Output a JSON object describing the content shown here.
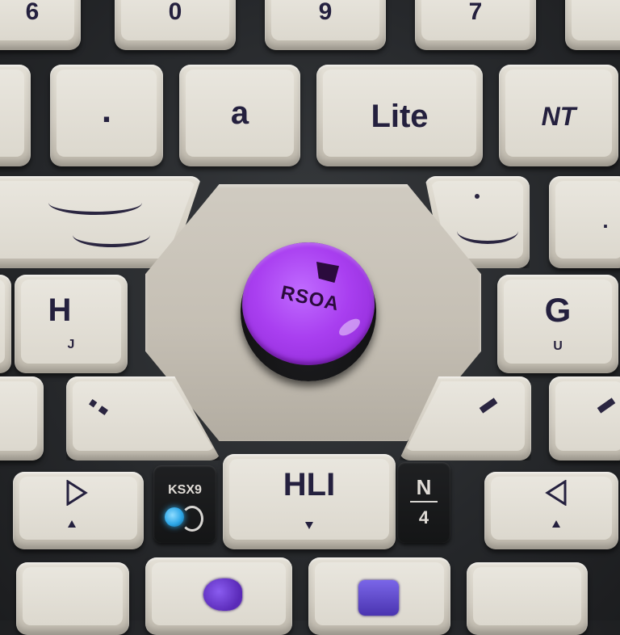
{
  "image": {
    "description_free": true
  },
  "top_row": {
    "k1": "6",
    "k2": "0",
    "k3": "9",
    "k4": "7"
  },
  "row2": {
    "k1": ".",
    "k2": "a",
    "k3": "Lite",
    "k4": "NT"
  },
  "row3": {
    "right_dot": "."
  },
  "row4": {
    "left_main": "H",
    "left_sub": "J",
    "right_main": "G",
    "right_sub": "U"
  },
  "center_button": {
    "label": "RSOA",
    "color": "#a93ff0"
  },
  "bottom_row": {
    "dark_left_text": "KSX9",
    "center_main": "HLI",
    "dark_right_main": "N",
    "dark_right_sub": "4"
  },
  "colors": {
    "keycap": "#dcd8ce",
    "legend": "#25203f",
    "purple": "#a93ff0",
    "blue_light": "#2fa8e8"
  }
}
